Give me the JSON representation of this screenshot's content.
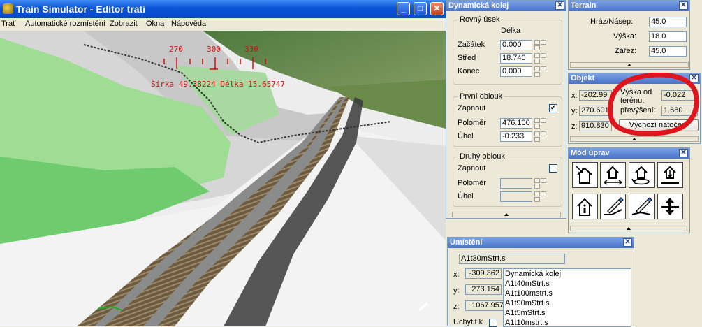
{
  "window": {
    "title": "Train Simulator - Editor trati",
    "menu": [
      "Trať",
      "Automatické rozmístění",
      "Zobrazit",
      "Okna",
      "Nápověda"
    ]
  },
  "viewport": {
    "compass_ticks": [
      "270",
      "300",
      "330"
    ],
    "coords_text": "Šírka 49.38224 Délka 15.65747"
  },
  "dyn_kolej": {
    "title": "Dynamická kolej",
    "rovny": {
      "title": "Rovný úsek",
      "col_header": "Délka",
      "rows": [
        {
          "label": "Začátek",
          "value": "0.000"
        },
        {
          "label": "Střed",
          "value": "18.740"
        },
        {
          "label": "Konec",
          "value": "0.000"
        }
      ]
    },
    "prvni": {
      "title": "První oblouk",
      "enable_label": "Zapnout",
      "enabled_mark": "✔",
      "radius_label": "Poloměr",
      "radius_value": "476.100",
      "angle_label": "Úhel",
      "angle_value": "-0.233"
    },
    "druhy": {
      "title": "Druhý oblouk",
      "enable_label": "Zapnout",
      "radius_label": "Poloměr",
      "angle_label": "Úhel"
    }
  },
  "terrain": {
    "title": "Terrain",
    "rows": [
      {
        "label": "Hráz/Násep:",
        "value": "45.0"
      },
      {
        "label": "Výška:",
        "value": "18.0"
      },
      {
        "label": "Zářez:",
        "value": "45.0"
      }
    ]
  },
  "objekt": {
    "title": "Objekt",
    "x_label": "x:",
    "x_value": "-202.99",
    "y_label": "y:",
    "y_value": "270.601",
    "z_label": "z:",
    "z_value": "910.830",
    "height_label_1": "Výška od",
    "height_label_2": "terénu:",
    "height_value": "-0.022",
    "cant_label": "převýšení:",
    "cant_value": "1.680",
    "reset_button": "Výchozí natočení"
  },
  "mod_uprav": {
    "title": "Mód úprav",
    "tools": [
      "move-object-icon",
      "move-horizontal-icon",
      "rotate-icon",
      "raise-lower-icon",
      "info-icon",
      "terrain-tilt-icon",
      "terrain-paint-icon",
      "height-adjust-icon"
    ]
  },
  "umisteni": {
    "title": "Umístění",
    "selected": "A1t30mStrt.s",
    "x_label": "x:",
    "x_value": "-309.362",
    "y_label": "y:",
    "y_value": "273.154",
    "z_label": "z:",
    "z_value": "1067.957",
    "snap_label": "Uchytit k",
    "list": [
      "Dynamická kolej",
      "A1t40mStrt.s",
      "A1t100mstrt.s",
      "A1t90mStrt.s",
      "A1t5mStrt.s",
      "A1t10mstrt.s"
    ]
  },
  "colors": {
    "annotation_red": "#e0141c",
    "xp_blue": "#0a55d8",
    "overlay_text_red": "#cc1010"
  }
}
